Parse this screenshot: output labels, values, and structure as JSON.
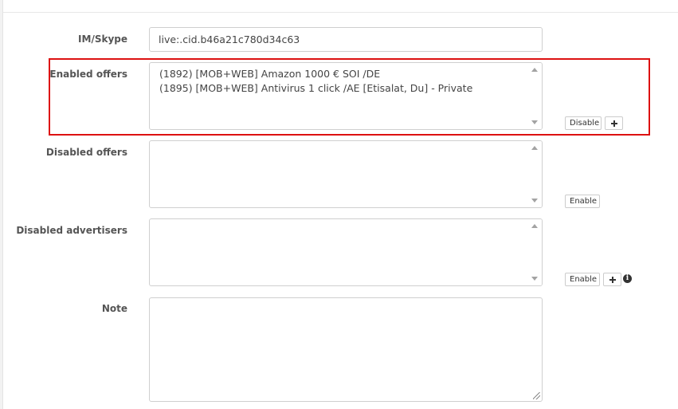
{
  "im_skype": {
    "label": "IM/Skype",
    "value": "live:.cid.b46a21c780d34c63"
  },
  "enabled_offers": {
    "label": "Enabled offers",
    "items": [
      "(1892) [MOB+WEB] Amazon 1000 € SOI /DE",
      "(1895) [MOB+WEB] Antivirus 1 click /AE [Etisalat, Du] - Private"
    ],
    "disable_label": "Disable",
    "add_icon": "plus-icon"
  },
  "disabled_offers": {
    "label": "Disabled offers",
    "items": [],
    "enable_label": "Enable"
  },
  "disabled_advertisers": {
    "label": "Disabled advertisers",
    "items": [],
    "enable_label": "Enable",
    "add_icon": "plus-icon",
    "info_icon": "info-circle-icon",
    "info_glyph": "i"
  },
  "note": {
    "label": "Note",
    "value": ""
  },
  "colors": {
    "highlight": "#dd1111",
    "border": "#cfcfcf",
    "label": "#555555"
  }
}
